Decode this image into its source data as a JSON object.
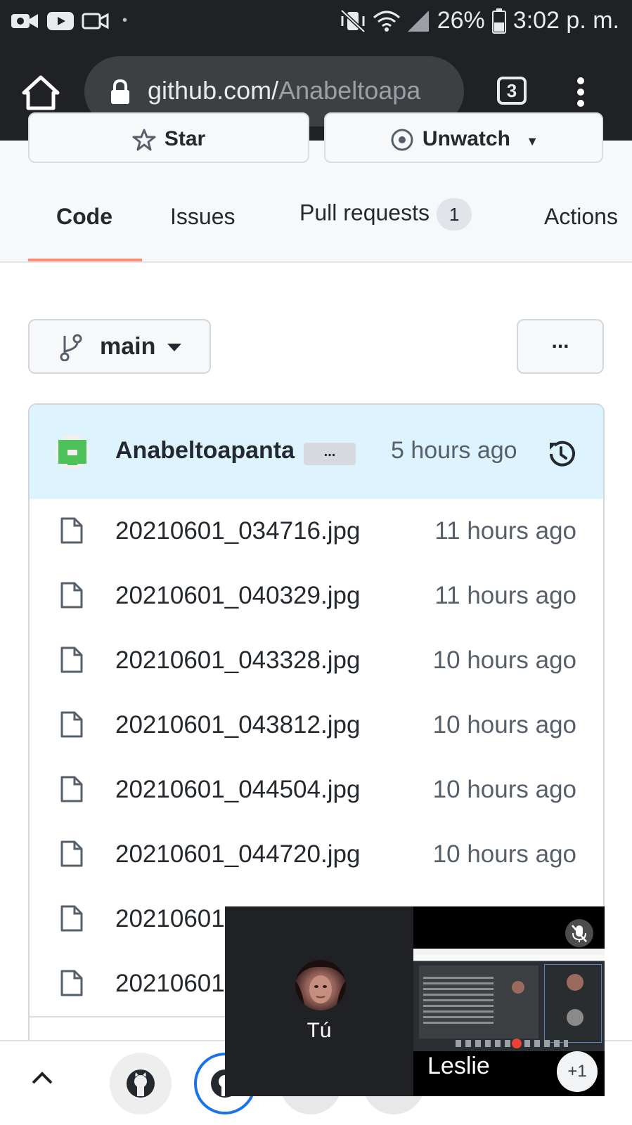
{
  "status_bar": {
    "battery": "26%",
    "time": "3:02 p. m.",
    "notification_icons": [
      "video-camera-icon",
      "youtube-icon",
      "camera-outline-icon",
      "dot-icon"
    ],
    "system_icons": [
      "vibrate-mute-icon",
      "wifi-icon",
      "signal-icon",
      "battery-icon"
    ]
  },
  "browser": {
    "url_host": "github.com/",
    "url_path": "Anabeltoapa",
    "tab_count": "3"
  },
  "repo_actions": {
    "star_label": "Star",
    "watch_label": "Unwatch"
  },
  "repo_tabs": [
    {
      "label": "Code",
      "active": true
    },
    {
      "label": "Issues"
    },
    {
      "label": "Pull requests",
      "count": "1"
    },
    {
      "label": "Actions"
    }
  ],
  "branch": {
    "name": "main",
    "more_label": "..."
  },
  "latest_commit": {
    "author": "Anabeltoapanta",
    "ellipsis": "...",
    "time": "5 hours ago"
  },
  "files": [
    {
      "name": "20210601_034716.jpg",
      "age": "11 hours ago"
    },
    {
      "name": "20210601_040329.jpg",
      "age": "11 hours ago"
    },
    {
      "name": "20210601_043328.jpg",
      "age": "10 hours ago"
    },
    {
      "name": "20210601_043812.jpg",
      "age": "10 hours ago"
    },
    {
      "name": "20210601_044504.jpg",
      "age": "10 hours ago"
    },
    {
      "name": "20210601_044720.jpg",
      "age": "10 hours ago"
    },
    {
      "name": "20210601",
      "age": ""
    },
    {
      "name": "20210601",
      "age": ""
    }
  ],
  "video_call": {
    "self_label": "Tú",
    "remote_name": "Leslie",
    "extra_participants": "+1"
  },
  "colors": {
    "chrome_dark": "#202124",
    "tab_underline": "#fd8c73",
    "commit_bg": "#ddf4ff",
    "tab_ring": "#1a73e8"
  }
}
